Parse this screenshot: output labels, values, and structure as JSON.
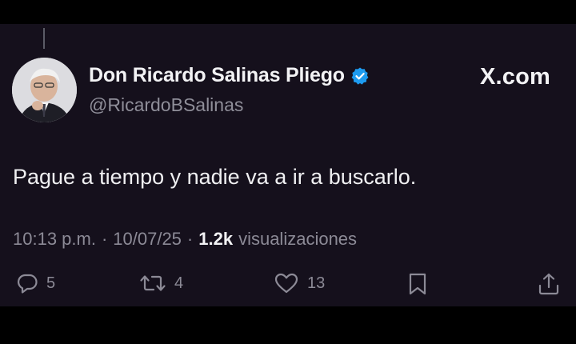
{
  "tweet": {
    "author_name": "Don Ricardo Salinas Pliego",
    "handle": "@RicardoBSalinas",
    "brand": "X.com",
    "text": "Pague a tiempo y nadie va a ir a buscarlo.",
    "time": "10:13 p.m.",
    "separator": "·",
    "date": "10/07/25",
    "views_count": "1.2k",
    "views_label": "visualizaciones"
  },
  "actions": {
    "replies": "5",
    "retweets": "4",
    "likes": "13"
  },
  "icons": {
    "verified": "verified-badge-icon",
    "reply": "reply-icon",
    "retweet": "retweet-icon",
    "like": "heart-icon",
    "bookmark": "bookmark-icon",
    "share": "share-icon"
  },
  "colors": {
    "background": "#15101c",
    "verified": "#1d9bf0",
    "muted": "#8c8a96"
  }
}
